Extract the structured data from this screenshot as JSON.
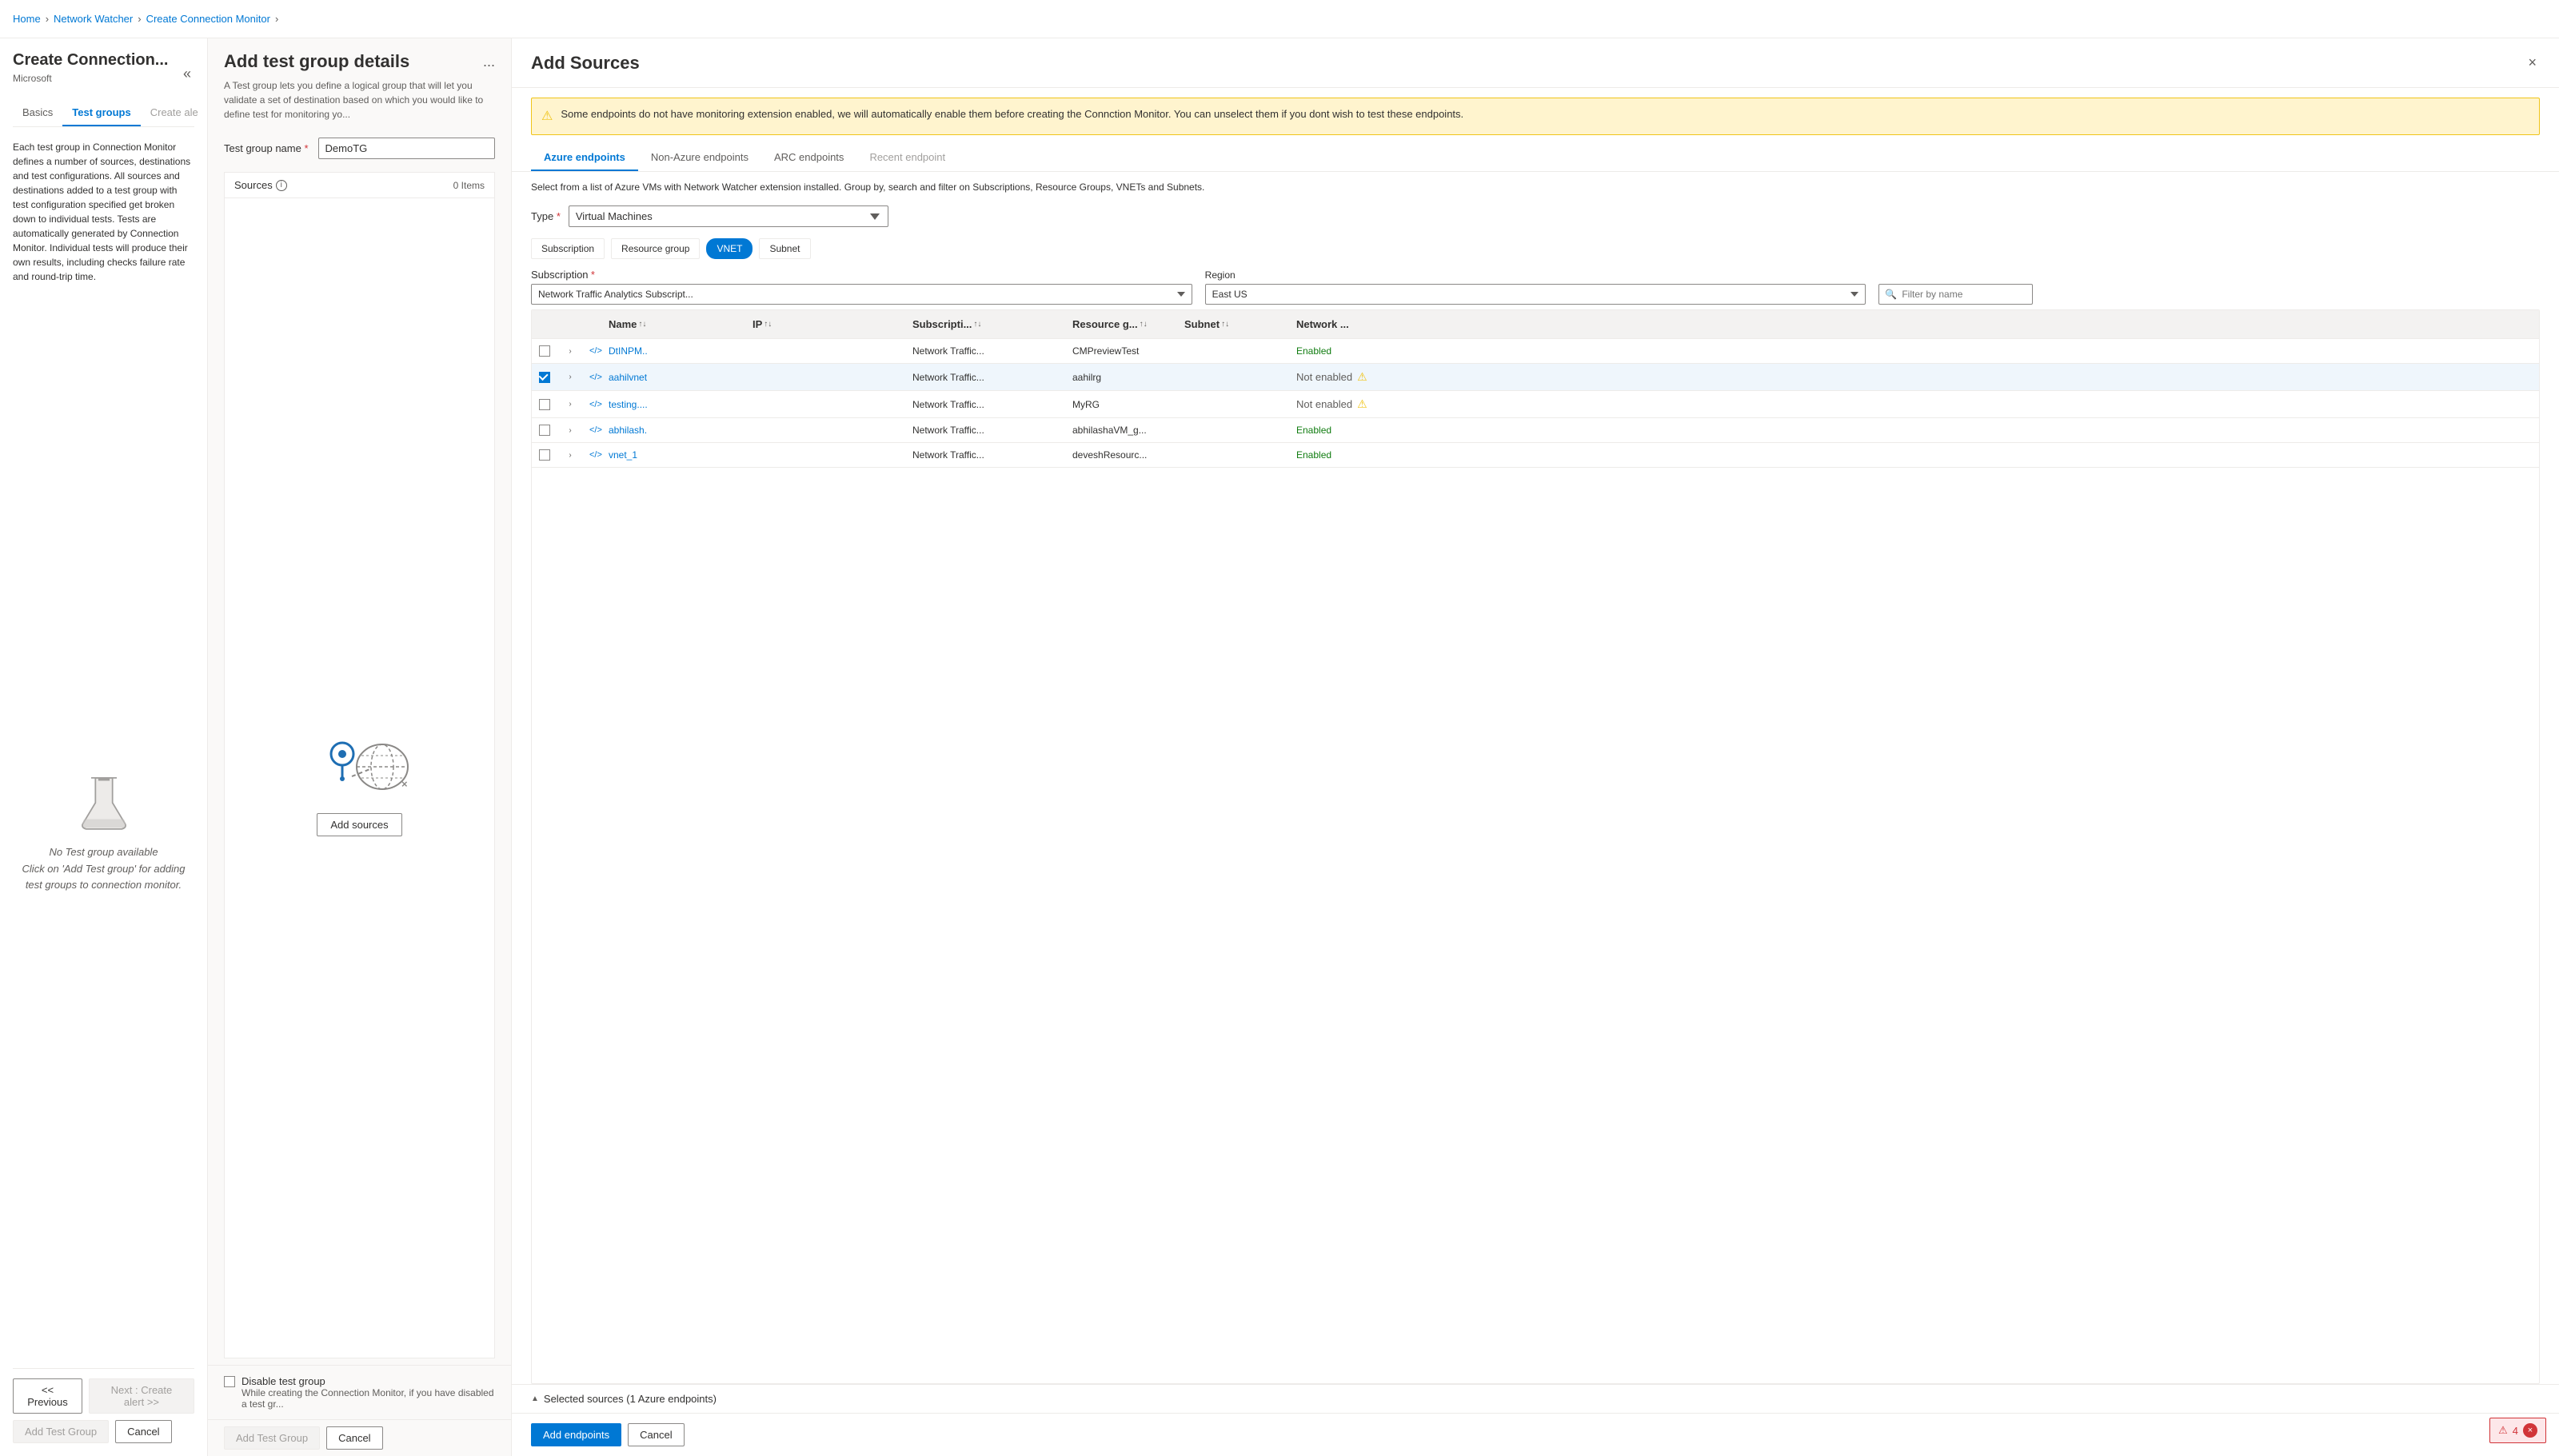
{
  "breadcrumb": {
    "items": [
      "Home",
      "Network Watcher",
      "Create Connection Monitor"
    ],
    "separators": [
      ">",
      ">",
      ">"
    ]
  },
  "sidebar": {
    "title": "Create Connection...",
    "subtitle": "Microsoft",
    "tabs": [
      {
        "label": "Basics",
        "state": "normal"
      },
      {
        "label": "Test groups",
        "state": "active"
      },
      {
        "label": "Create ale",
        "state": "disabled"
      }
    ],
    "more_label": "...",
    "description": "Each test group in Connection Monitor defines a number of sources, destinations and test configurations. All sources and destinations added to a test group with test configuration specified get broken down to individual tests. Tests are automatically generated by Connection Monitor. Individual tests will produce their own results, including checks failure rate and round-trip time.",
    "empty_line1": "No Test group available",
    "empty_line2": "Click on 'Add Test group' for adding test groups to connection monitor.",
    "buttons": {
      "previous": "<< Previous",
      "next": "Next : Create alert >>",
      "add_test_group": "Add Test Group",
      "cancel": "Cancel"
    }
  },
  "center": {
    "title": "Add test group details",
    "more": "...",
    "description": "A Test group lets you define a logical group that will let you validate a set of destination based on which you would like to define test for monitoring yo...",
    "form": {
      "test_group_label": "Test group name",
      "test_group_required": "*",
      "test_group_value": "DemoTG"
    },
    "sources": {
      "label": "Sources",
      "count": "0 Items",
      "info": "i"
    },
    "disable": {
      "checkbox_label": "Disable test group",
      "description": "While creating the Connection Monitor, if you have disabled a test gr..."
    },
    "buttons": {
      "add_test_group": "Add Test Group",
      "cancel": "Cancel",
      "add_sources": "Add sources"
    }
  },
  "add_sources": {
    "title": "Add Sources",
    "close": "×",
    "warning": "Some endpoints do not have monitoring extension enabled, we will automatically enable them before creating the Connction Monitor. You can unselect them if you dont wish to test these endpoints.",
    "tabs": [
      {
        "label": "Azure endpoints",
        "state": "active"
      },
      {
        "label": "Non-Azure endpoints",
        "state": "normal"
      },
      {
        "label": "ARC endpoints",
        "state": "normal"
      },
      {
        "label": "Recent endpoint",
        "state": "disabled"
      }
    ],
    "description": "Select from a list of Azure VMs with Network Watcher extension installed. Group by, search and filter on Subscriptions, Resource Groups, VNETs and Subnets.",
    "type_label": "Type",
    "type_required": "*",
    "type_value": "Virtual Machines",
    "filter_buttons": [
      {
        "label": "Subscription",
        "active": false
      },
      {
        "label": "Resource group",
        "active": false
      },
      {
        "label": "VNET",
        "active": true
      },
      {
        "label": "Subnet",
        "active": false
      }
    ],
    "subscription_label": "Subscription",
    "subscription_required": "*",
    "subscription_value": "Network Traffic Analytics Subscript...",
    "region_label": "Region",
    "region_value": "East US",
    "filter_placeholder": "Filter by name",
    "table": {
      "headers": [
        {
          "label": "",
          "sort": false
        },
        {
          "label": "",
          "sort": false
        },
        {
          "label": "",
          "sort": false
        },
        {
          "label": "Name",
          "sort": true
        },
        {
          "label": "IP",
          "sort": true
        },
        {
          "label": "Subscripti...",
          "sort": true
        },
        {
          "label": "Resource g...",
          "sort": true
        },
        {
          "label": "Subnet",
          "sort": true
        },
        {
          "label": "Network ...",
          "sort": false
        }
      ],
      "rows": [
        {
          "checked": false,
          "expanded": false,
          "icon": "</>",
          "name": "DtINPM..",
          "ip": "",
          "subscription": "Network Traffic...",
          "resource_group": "CMPreviewTest",
          "subnet": "",
          "network": "Enabled",
          "warning": false,
          "selected": false
        },
        {
          "checked": true,
          "expanded": false,
          "icon": "</>",
          "name": "aahilvnet",
          "ip": "",
          "subscription": "Network Traffic...",
          "resource_group": "aahilrg",
          "subnet": "",
          "network": "Not enabled",
          "warning": true,
          "selected": true
        },
        {
          "checked": false,
          "expanded": false,
          "icon": "</>",
          "name": "testing....",
          "ip": "",
          "subscription": "Network Traffic...",
          "resource_group": "MyRG",
          "subnet": "",
          "network": "Not enabled",
          "warning": true,
          "selected": false
        },
        {
          "checked": false,
          "expanded": false,
          "icon": "</>",
          "name": "abhilash.",
          "ip": "",
          "subscription": "Network Traffic...",
          "resource_group": "abhilashaVM_g...",
          "subnet": "",
          "network": "Enabled",
          "warning": false,
          "selected": false
        },
        {
          "checked": false,
          "expanded": false,
          "icon": "</>",
          "name": "vnet_1",
          "ip": "",
          "subscription": "Network Traffic...",
          "resource_group": "deveshResourc...",
          "subnet": "",
          "network": "Enabled",
          "warning": false,
          "selected": false
        }
      ]
    },
    "selected_footer": "Selected sources (1 Azure endpoints)",
    "buttons": {
      "add_endpoints": "Add endpoints",
      "cancel": "Cancel"
    }
  },
  "error_badge": {
    "warning_icon": "⚠",
    "count": "4",
    "close_icon": "×"
  },
  "colors": {
    "primary": "#0078d4",
    "warning": "#f0c419",
    "error": "#d13438",
    "success": "#107c10",
    "bg": "#faf9f8"
  }
}
